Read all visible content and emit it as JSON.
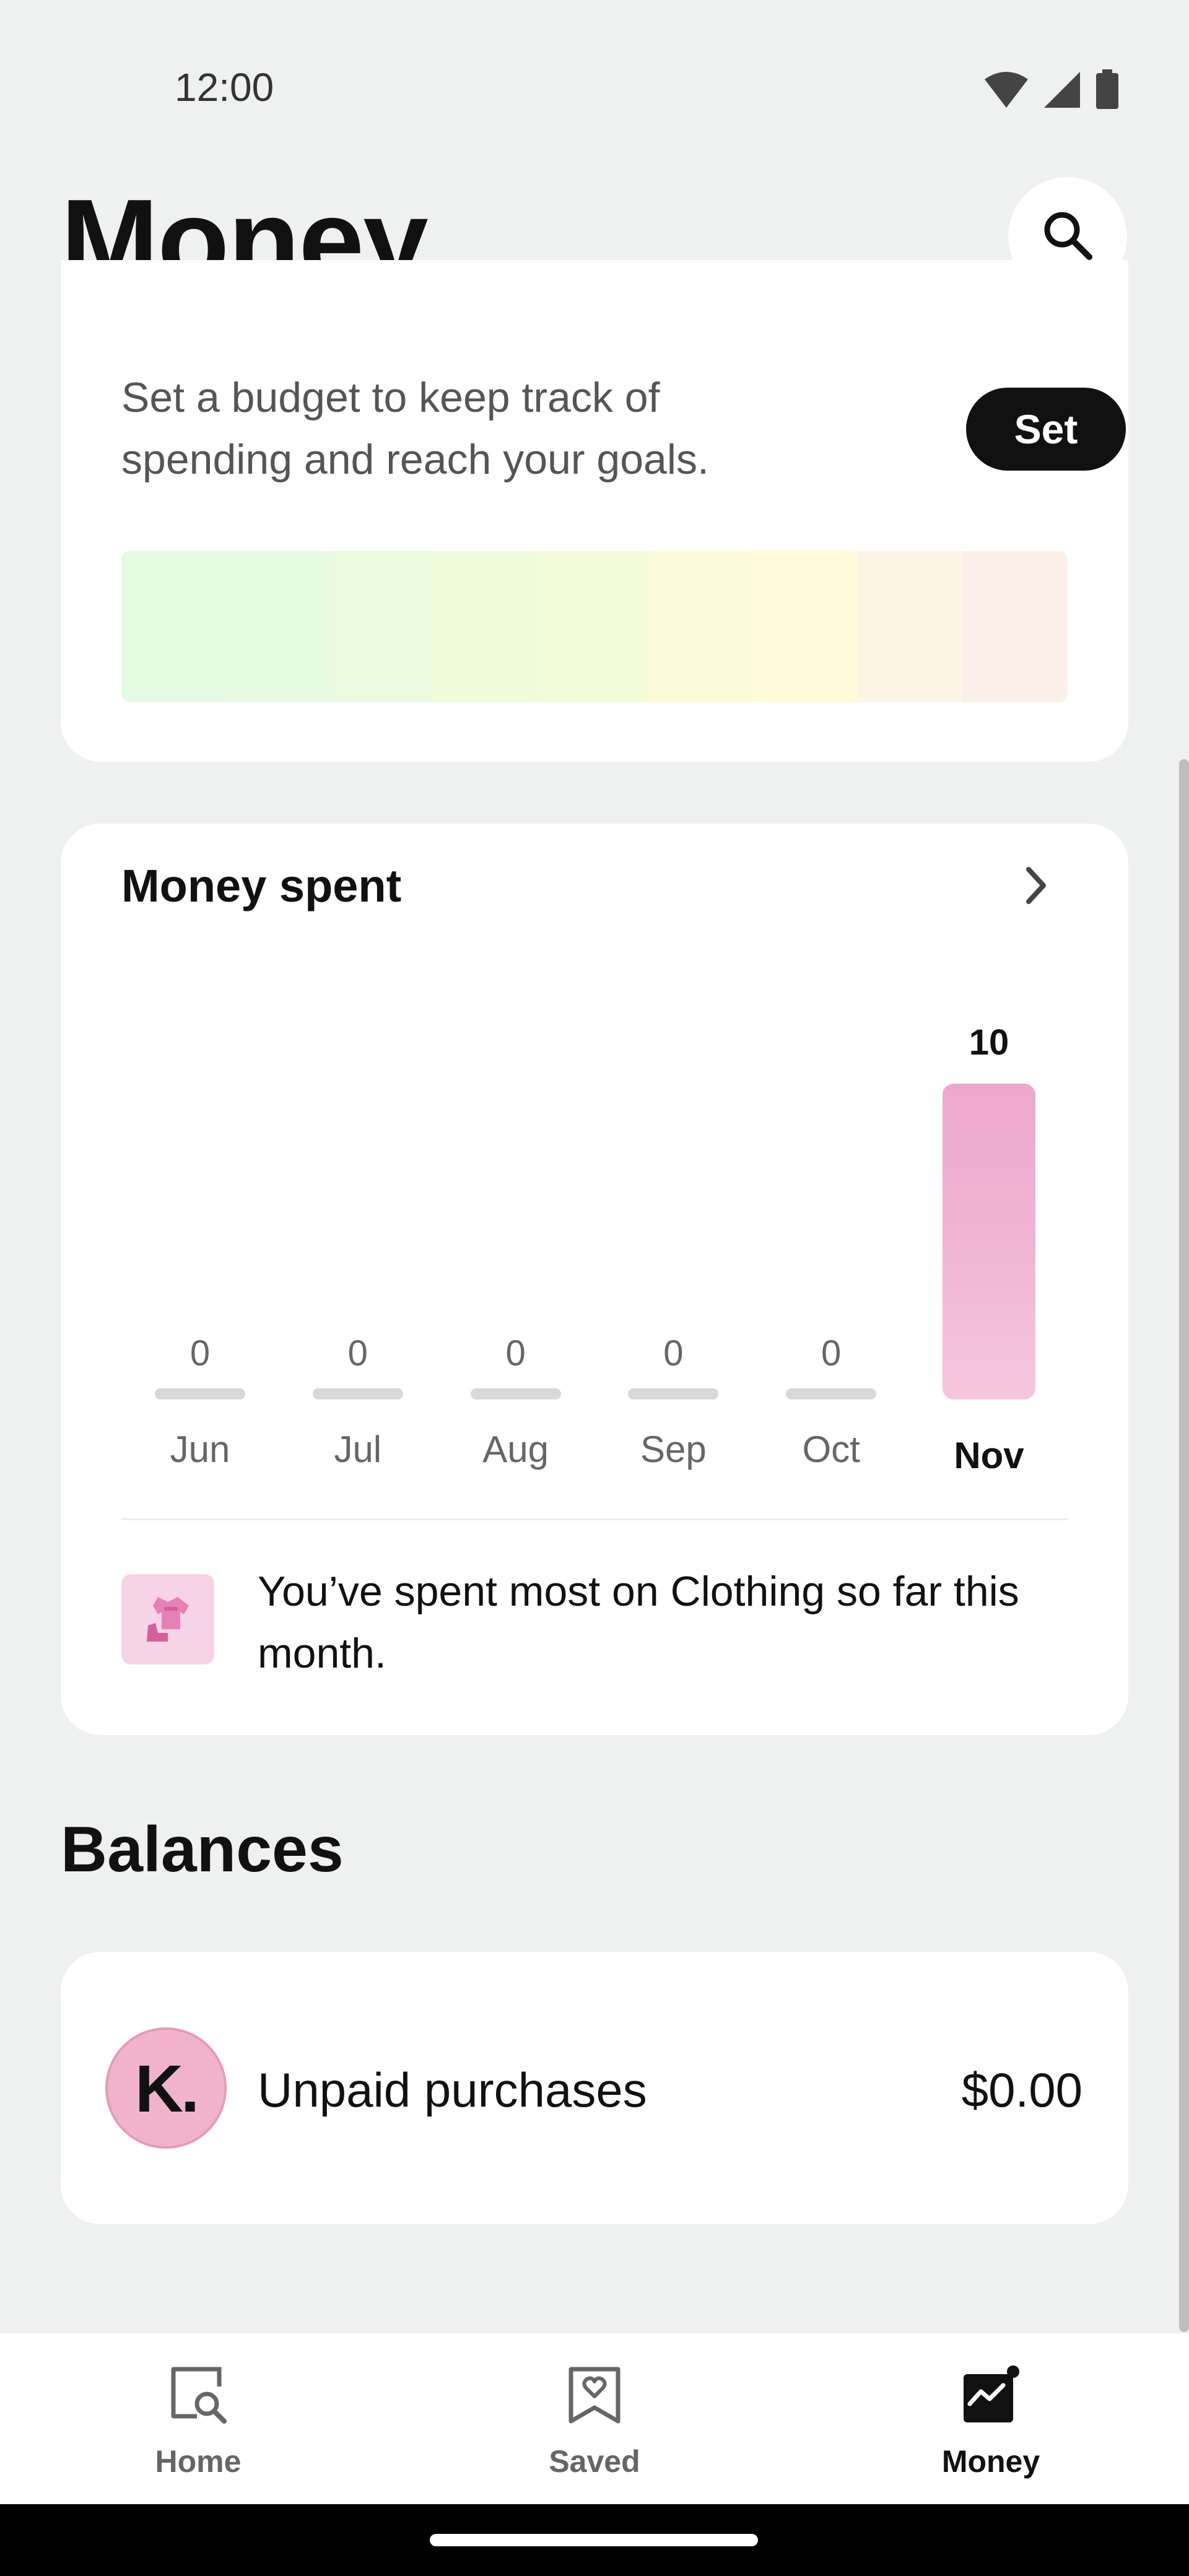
{
  "status_bar": {
    "time": "12:00",
    "icons": [
      "wifi-icon",
      "signal-icon",
      "battery-icon"
    ]
  },
  "header": {
    "title": "Money",
    "search_icon": "search-icon"
  },
  "budget": {
    "description": "Set a budget to keep track of spending and reach your goals.",
    "set_label": "Set",
    "gradient_colors": [
      "#e3fbe2",
      "#e6fbe0",
      "#ecfbde",
      "#f0fbdb",
      "#f4fbd8",
      "#fbfbd8",
      "#fffbd8",
      "#fef4e4",
      "#fcefe9"
    ]
  },
  "money_spent": {
    "title": "Money spent",
    "chevron_icon": "chevron-right-icon",
    "insight_icon": "clothing-icon",
    "insight_text": "You’ve spent most on Clothing so far this month.",
    "accent_color": "#eda8cd"
  },
  "chart_data": {
    "type": "bar",
    "categories": [
      "Jun",
      "Jul",
      "Aug",
      "Sep",
      "Oct",
      "Nov"
    ],
    "values": [
      0,
      0,
      0,
      0,
      0,
      10
    ],
    "value_labels": [
      "0",
      "0",
      "0",
      "0",
      "0",
      "10"
    ],
    "highlighted": "Nov",
    "ylim": [
      0,
      10
    ],
    "grid": false,
    "legend": "none"
  },
  "balances": {
    "title": "Balances",
    "items": [
      {
        "avatar_text": "K.",
        "label": "Unpaid purchases",
        "amount": "$0.00"
      }
    ]
  },
  "bottom_nav": {
    "items": [
      {
        "label": "Home",
        "icon": "home-search-icon",
        "active": false
      },
      {
        "label": "Saved",
        "icon": "saved-heart-icon",
        "active": false
      },
      {
        "label": "Money",
        "icon": "money-chart-icon",
        "active": true
      }
    ]
  }
}
